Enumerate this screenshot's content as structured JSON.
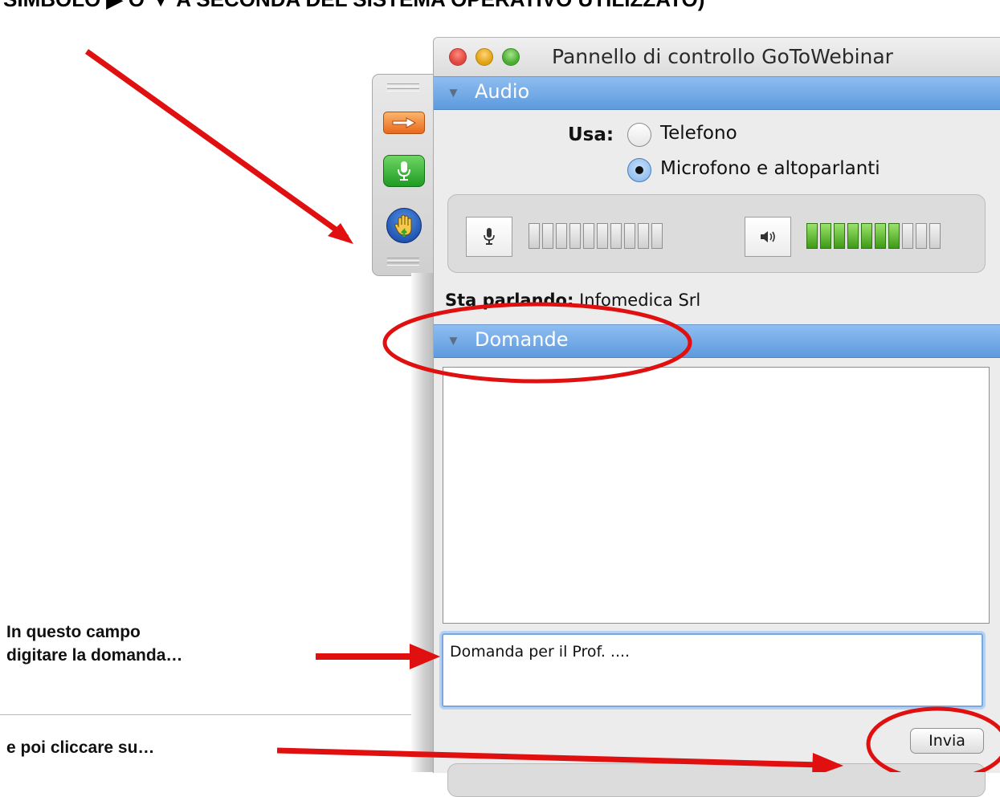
{
  "document": {
    "heading": "SIMBOLO ▶ O ▼ A SECONDA DEL SISTEMA OPERATIVO UTILIZZATO)",
    "caption_field": [
      "In questo campo",
      "digitare la domanda…"
    ],
    "caption_click": "e poi cliccare su…"
  },
  "window": {
    "title": "Pannello di controllo GoToWebinar"
  },
  "toolbar": {
    "icons": [
      "arrow-icon",
      "microphone-icon",
      "raise-hand-icon"
    ]
  },
  "audio": {
    "section_label": "Audio",
    "use_label": "Usa:",
    "options": [
      {
        "label": "Telefono",
        "selected": false
      },
      {
        "label": "Microfono e altoparlanti",
        "selected": true
      }
    ],
    "mic_level": {
      "lit": 0,
      "total": 10
    },
    "speaker_level": {
      "lit": 7,
      "total": 10
    },
    "speaking_label": "Sta parlando:",
    "speaking_name": "Infomedica Srl"
  },
  "questions": {
    "section_label": "Domande",
    "input_value": "Domanda per il Prof. ....",
    "send_label": "Invia"
  },
  "colors": {
    "section_blue": "#6ea8e8",
    "annotation_red": "#e01010",
    "meter_green": "#4caf2a"
  }
}
